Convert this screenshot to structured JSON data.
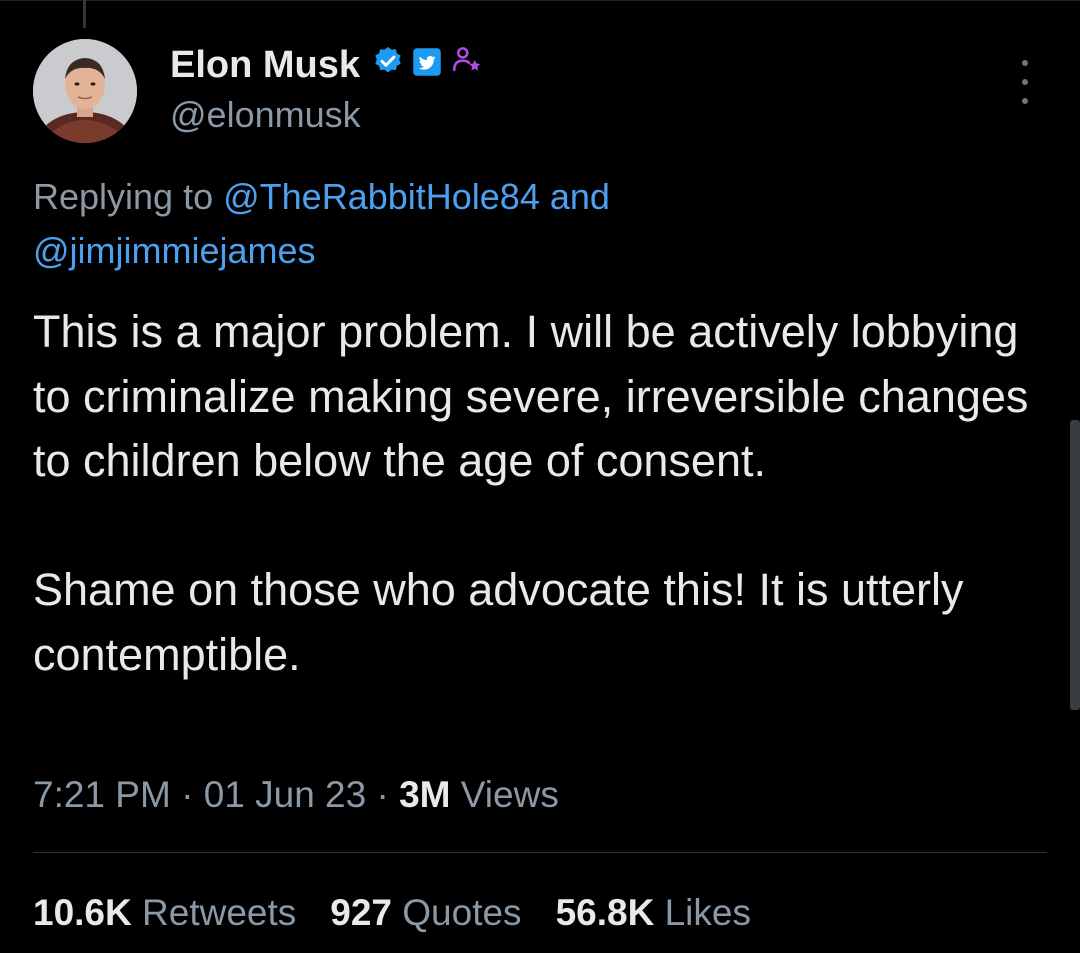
{
  "author": {
    "display_name": "Elon Musk",
    "handle": "@elonmusk",
    "avatar": "avatar-photo",
    "badges": [
      "verified-badge-icon",
      "twitter-bird-badge-icon",
      "affiliate-person-star-icon"
    ]
  },
  "reply": {
    "prefix": "Replying to",
    "mention_1": "@TheRabbitHole84",
    "conjunction": "and",
    "mention_2": "@jimjimmiejames"
  },
  "tweet": {
    "paragraph_1": "This is a major problem. I will be actively lobbying to criminalize making severe, irreversible changes to children below the age of consent.",
    "paragraph_2": "Shame on those who advocate this! It is utterly contemptible."
  },
  "meta": {
    "time": "7:21 PM",
    "separator": "·",
    "date": "01 Jun 23",
    "views_count": "3M",
    "views_label": "Views"
  },
  "stats": {
    "retweets_count": "10.6K",
    "retweets_label": "Retweets",
    "quotes_count": "927",
    "quotes_label": "Quotes",
    "likes_count": "56.8K",
    "likes_label": "Likes"
  },
  "colors": {
    "background": "#000000",
    "text_primary": "#e7e9ea",
    "text_secondary": "#8b98a5",
    "link": "#4da0f0",
    "verified": "#1d9bf0",
    "affiliate": "#b04ae0"
  }
}
